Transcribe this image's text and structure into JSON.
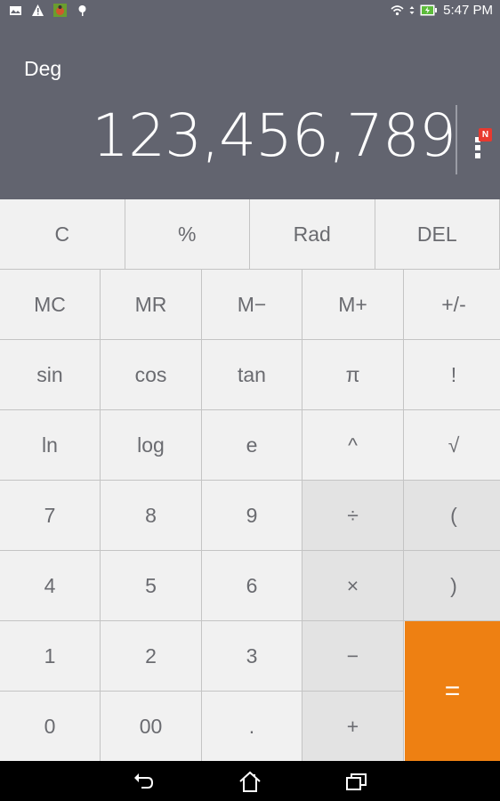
{
  "status_bar": {
    "left_icons": [
      "image-notification-icon",
      "warning-icon",
      "bug-app-icon",
      "android-debug-icon"
    ],
    "right_icons": [
      "wifi-icon",
      "data-arrows-icon",
      "battery-charging-icon"
    ],
    "time": "5:47 PM"
  },
  "display": {
    "angle_mode": "Deg",
    "value": "123,456,789",
    "menu_badge": "N"
  },
  "colors": {
    "accent": "#ee8012",
    "display_bg": "#62646f",
    "badge": "#e8392f"
  },
  "keys": {
    "row0": [
      "C",
      "%",
      "Rad",
      "DEL"
    ],
    "row1": [
      "MC",
      "MR",
      "M−",
      "M+",
      "+/-"
    ],
    "row2": [
      "sin",
      "cos",
      "tan",
      "π",
      "!"
    ],
    "row3": [
      "ln",
      "log",
      "e",
      "^",
      "√"
    ],
    "row4": [
      "7",
      "8",
      "9",
      "÷",
      "("
    ],
    "row5": [
      "4",
      "5",
      "6",
      "×",
      ")"
    ],
    "row6": [
      "1",
      "2",
      "3",
      "−"
    ],
    "row7": [
      "0",
      "00",
      ".",
      "+"
    ],
    "equals": "="
  },
  "nav_bar": [
    "back-icon",
    "home-icon",
    "recent-apps-icon"
  ]
}
